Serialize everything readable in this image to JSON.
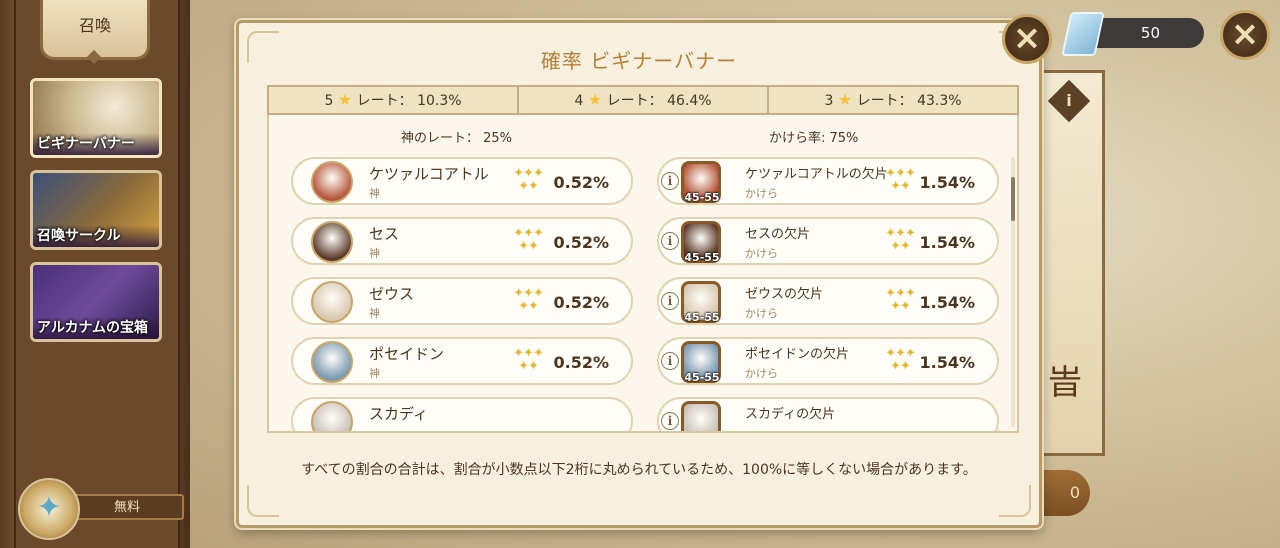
{
  "sidebar": {
    "title": "召喚",
    "tabs": [
      {
        "label": "ビギナーバナー",
        "selected": true
      },
      {
        "label": "召喚サークル",
        "selected": false
      },
      {
        "label": "アルカナムの宝箱",
        "selected": false
      }
    ],
    "free_label": "無料"
  },
  "currency": {
    "gems": "50"
  },
  "background": {
    "banner_char": "旹",
    "pill_value": "0",
    "info_glyph": "i"
  },
  "dialog": {
    "title": "確率 ビギナーバナー",
    "rates": [
      {
        "stars": "5",
        "text": "レート：",
        "value": "10.3%"
      },
      {
        "stars": "4",
        "text": "レート：",
        "value": "46.4%"
      },
      {
        "stars": "3",
        "text": "レート：",
        "value": "43.3%"
      }
    ],
    "left_header": "神のレート：  25%",
    "right_header": "かけら率: 75%",
    "gods": [
      {
        "name": "ケツァルコアトル",
        "sub": "神",
        "pct": "0.52%",
        "color": "#b5553a"
      },
      {
        "name": "セス",
        "sub": "神",
        "pct": "0.52%",
        "color": "#5a3a2a"
      },
      {
        "name": "ゼウス",
        "sub": "神",
        "pct": "0.52%",
        "color": "#d8c8b0"
      },
      {
        "name": "ポセイドン",
        "sub": "神",
        "pct": "0.52%",
        "color": "#7a98b0"
      },
      {
        "name": "スカディ",
        "sub": "",
        "pct": "",
        "color": "#c8c0b8"
      }
    ],
    "fragments": [
      {
        "name": "ケツァルコアトルの欠片",
        "sub": "かけら",
        "pct": "1.54%",
        "level": "45-55",
        "color": "#b5553a"
      },
      {
        "name": "セスの欠片",
        "sub": "かけら",
        "pct": "1.54%",
        "level": "45-55",
        "color": "#5a3a2a"
      },
      {
        "name": "ゼウスの欠片",
        "sub": "かけら",
        "pct": "1.54%",
        "level": "45-55",
        "color": "#d8c8b0"
      },
      {
        "name": "ポセイドンの欠片",
        "sub": "かけら",
        "pct": "1.54%",
        "level": "45-55",
        "color": "#7a98b0"
      },
      {
        "name": "スカディの欠片",
        "sub": "",
        "pct": "",
        "level": "",
        "color": "#c8c0b8"
      }
    ],
    "star_glyphs": "✦✦✦\n✦✦",
    "info_glyph": "i",
    "footer_note": "すべての割合の合計は、割合が小数点以下2桁に丸められているため、100%に等しくない場合があります。"
  },
  "icons": {
    "close": "×",
    "star": "★",
    "gem": "gem-icon"
  }
}
